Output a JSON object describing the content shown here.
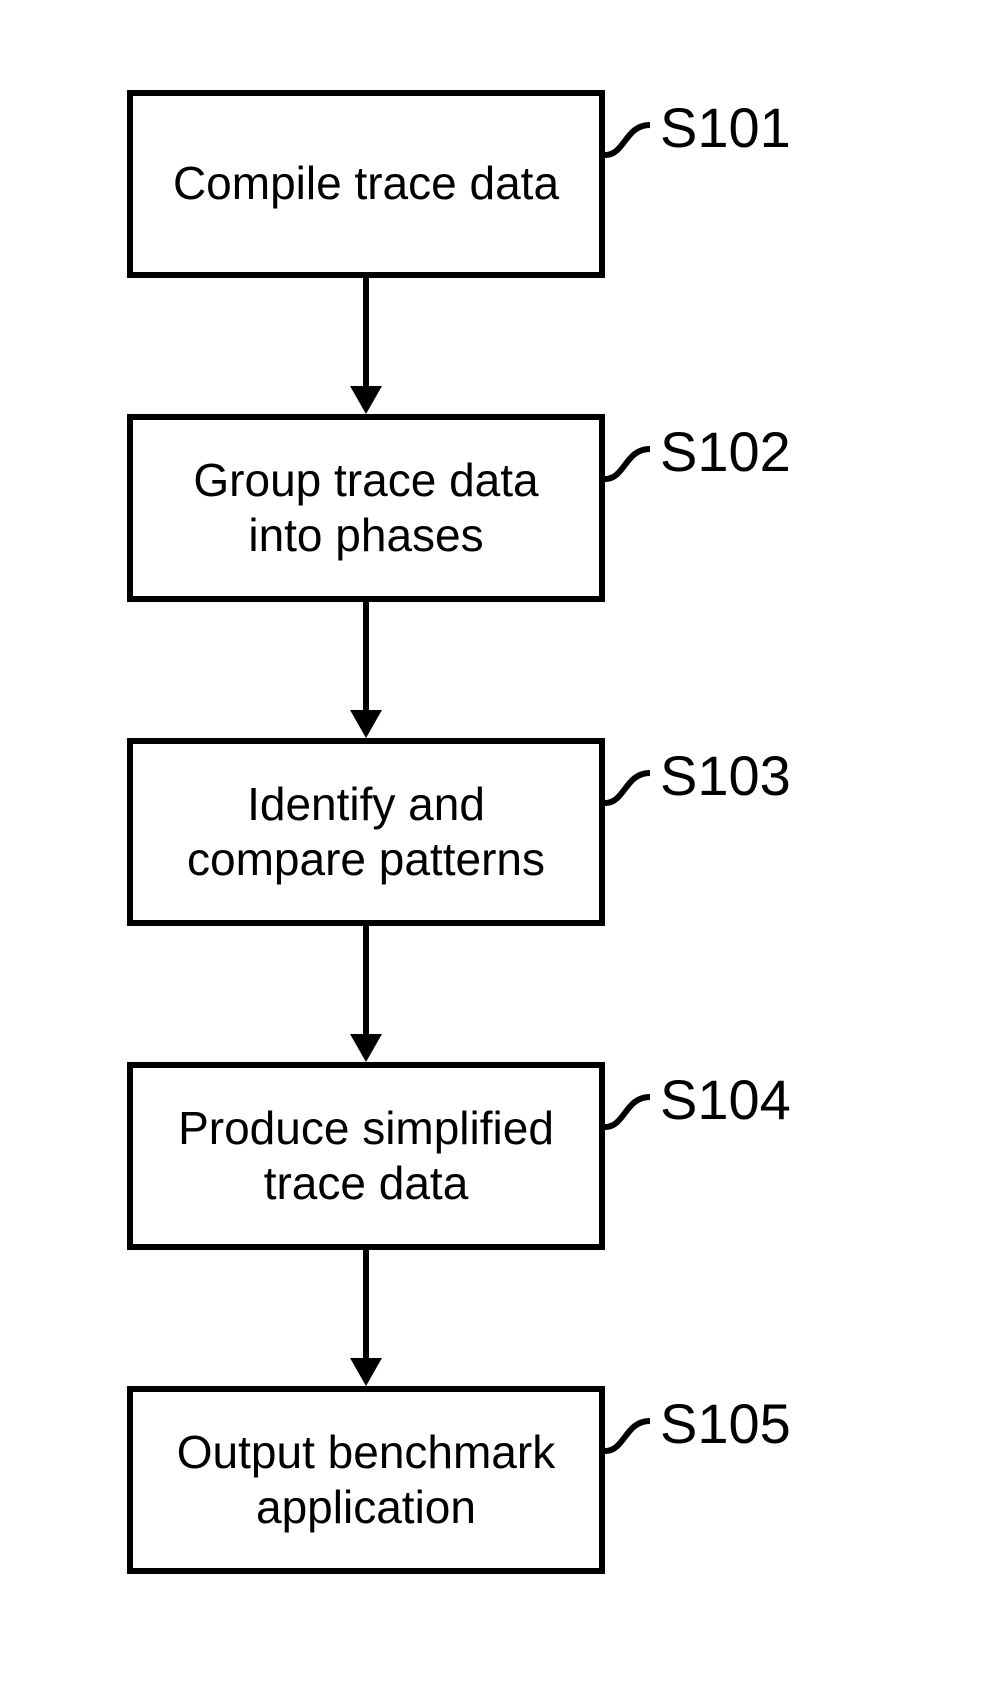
{
  "chart_data": {
    "type": "flowchart",
    "direction": "top-to-bottom",
    "nodes": [
      {
        "id": "S101",
        "text": "Compile trace data"
      },
      {
        "id": "S102",
        "text": "Group trace data into phases"
      },
      {
        "id": "S103",
        "text": "Identify and compare patterns"
      },
      {
        "id": "S104",
        "text": "Produce simplified trace data"
      },
      {
        "id": "S105",
        "text": "Output benchmark application"
      }
    ],
    "edges": [
      {
        "from": "S101",
        "to": "S102"
      },
      {
        "from": "S102",
        "to": "S103"
      },
      {
        "from": "S103",
        "to": "S104"
      },
      {
        "from": "S104",
        "to": "S105"
      }
    ]
  },
  "steps": {
    "s101": {
      "text": "Compile trace data",
      "label": "S101"
    },
    "s102": {
      "text": "Group trace data\ninto phases",
      "label": "S102"
    },
    "s103": {
      "text": "Identify and\ncompare patterns",
      "label": "S103"
    },
    "s104": {
      "text": "Produce simplified\ntrace data",
      "label": "S104"
    },
    "s105": {
      "text": "Output benchmark\napplication",
      "label": "S105"
    }
  }
}
